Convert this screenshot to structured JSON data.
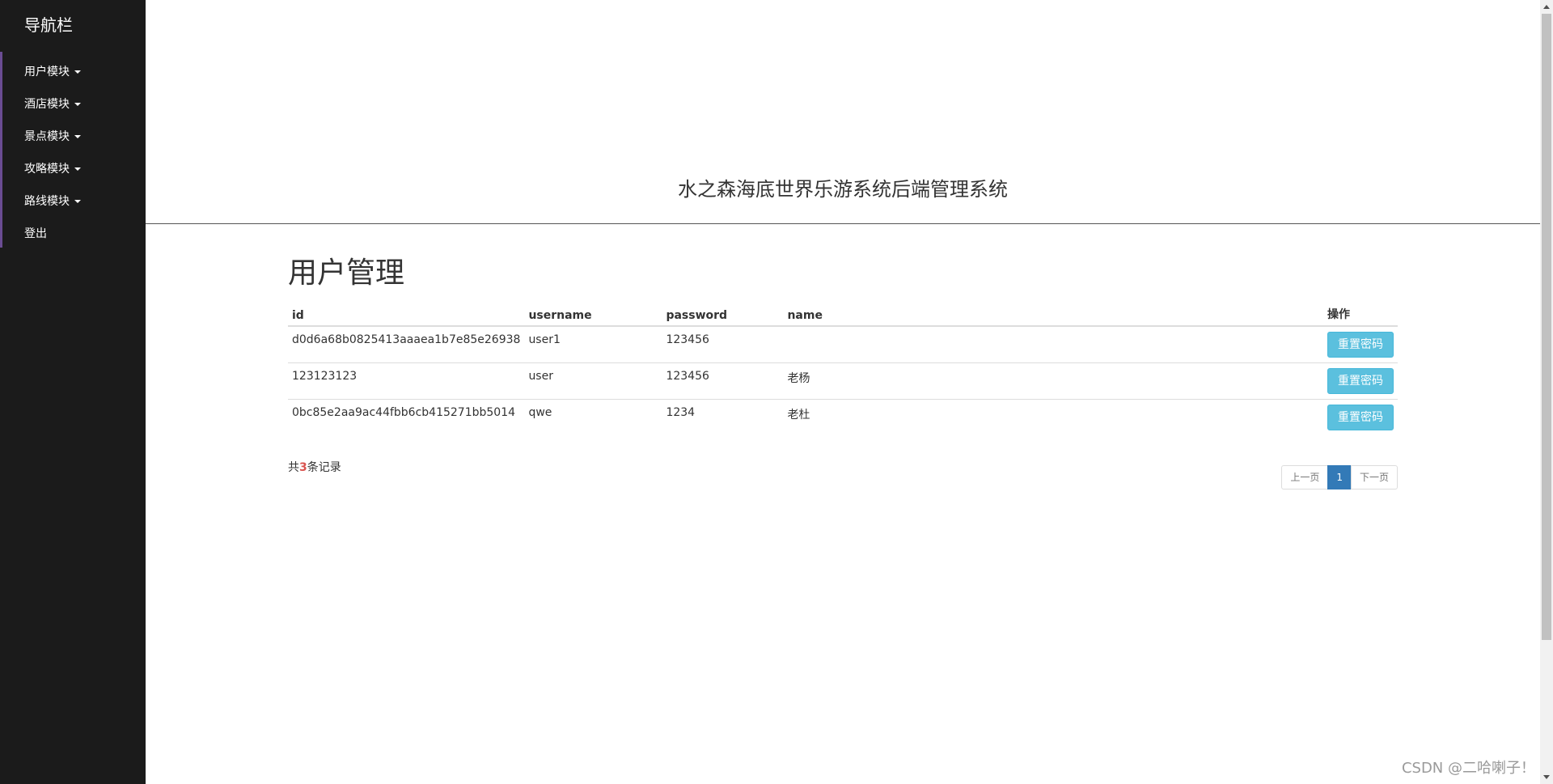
{
  "sidebar": {
    "brand": "导航栏",
    "items": [
      {
        "label": "用户模块",
        "dropdown": true
      },
      {
        "label": "酒店模块",
        "dropdown": true
      },
      {
        "label": "景点模块",
        "dropdown": true
      },
      {
        "label": "攻略模块",
        "dropdown": true
      },
      {
        "label": "路线模块",
        "dropdown": true
      },
      {
        "label": "登出",
        "dropdown": false
      }
    ]
  },
  "header": {
    "system_title": "水之森海底世界乐游系统后端管理系统"
  },
  "main": {
    "page_heading": "用户管理",
    "table": {
      "columns": [
        "id",
        "username",
        "password",
        "name",
        "操作"
      ],
      "rows": [
        {
          "id": "d0d6a68b0825413aaaea1b7e85e26938",
          "username": "user1",
          "password": "123456",
          "name": "",
          "action": "重置密码"
        },
        {
          "id": "123123123",
          "username": "user",
          "password": "123456",
          "name": "老杨",
          "action": "重置密码"
        },
        {
          "id": "0bc85e2aa9ac44fbb6cb415271bb5014",
          "username": "qwe",
          "password": "1234",
          "name": "老杜",
          "action": "重置密码"
        }
      ]
    },
    "record_count": {
      "prefix": "共",
      "count": "3",
      "suffix": "条记录"
    },
    "pagination": {
      "prev": "上一页",
      "current": "1",
      "next": "下一页"
    }
  },
  "watermark": "CSDN @二哈喇子！",
  "colors": {
    "sidebar_bg": "#1b1b1b",
    "sidebar_accent": "#6a4c93",
    "button_info": "#5bc0de",
    "pagination_active": "#337ab7",
    "count_highlight": "#d9534f"
  }
}
